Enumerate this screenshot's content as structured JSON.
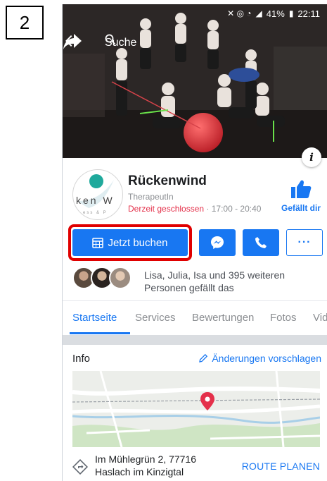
{
  "step": "2",
  "status_bar": {
    "battery": "41%",
    "time": "22:11"
  },
  "top_bar": {
    "search_placeholder": "Suche"
  },
  "page": {
    "name": "Rückenwind",
    "category": "TherapeutIn",
    "status_closed": "Derzeit geschlossen",
    "hours": "· 17:00 - 20:40",
    "like_label": "Gefällt dir",
    "logo_text": "ken W"
  },
  "actions": {
    "book_label": "Jetzt buchen",
    "more_label": "···"
  },
  "friends": {
    "text": "Lisa, Julia, Isa und 395 weiteren Personen gefällt das"
  },
  "tabs": [
    {
      "label": "Startseite",
      "active": true
    },
    {
      "label": "Services",
      "active": false
    },
    {
      "label": "Bewertungen",
      "active": false
    },
    {
      "label": "Fotos",
      "active": false
    },
    {
      "label": "Vid",
      "active": false
    }
  ],
  "info": {
    "title": "Info",
    "edit_label": "Änderungen vorschlagen",
    "address_line1": "Im Mühlegrün 2, 77716",
    "address_line2": "Haslach im Kinzigtal",
    "route_label": "ROUTE PLANEN"
  },
  "colors": {
    "brand_blue": "#1877f2",
    "closed_red": "#e4304a",
    "highlight_red": "#e00000",
    "map_pin": "#e4304a"
  },
  "icons": {
    "back": "arrow-left-icon",
    "search": "search-icon",
    "share": "share-arrow-icon",
    "info": "info-icon",
    "like": "thumbs-up-icon",
    "calendar": "calendar-icon",
    "messenger": "messenger-icon",
    "call": "phone-icon",
    "edit": "pencil-icon",
    "directions": "directions-icon",
    "map_pin": "map-pin-icon"
  }
}
